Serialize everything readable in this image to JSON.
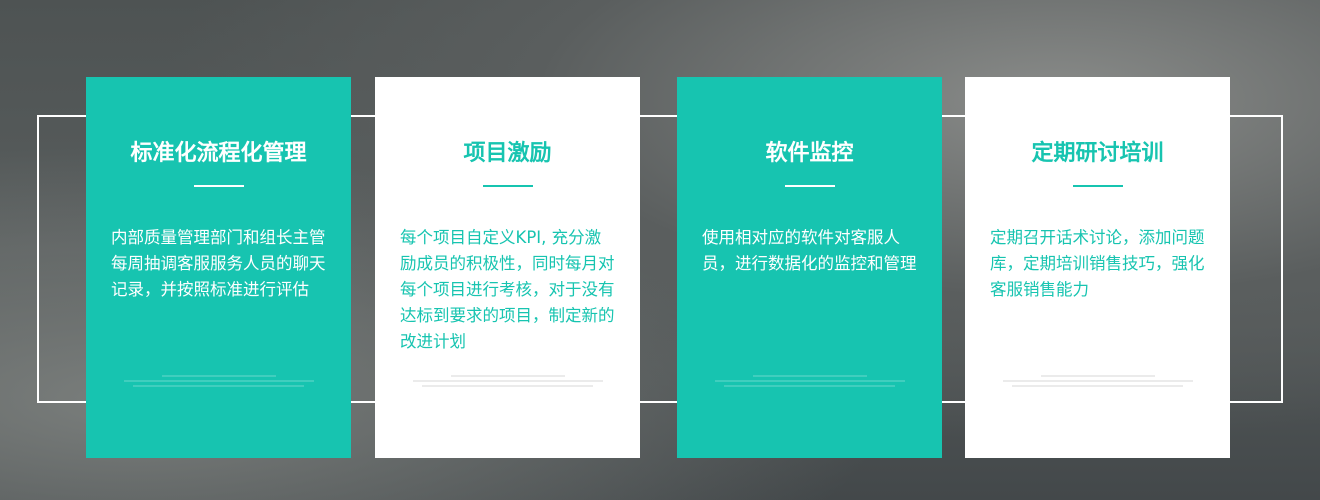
{
  "cards": [
    {
      "title": "标准化流程化管理",
      "body": "内部质量管理部门和组长主管每周抽调客服服务人员的聊天记录，并按照标准进行评估",
      "style": "teal"
    },
    {
      "title": "项目激励",
      "body": "每个项目自定义KPI, 充分激励成员的积极性，同时每月对每个项目进行考核，对于没有达标到要求的项目，制定新的改进计划",
      "style": "white"
    },
    {
      "title": "软件监控",
      "body": "使用相对应的软件对客服人员，进行数据化的监控和管理",
      "style": "teal"
    },
    {
      "title": "定期研讨培训",
      "body": "定期召开话术讨论，添加问题库，定期培训销售技巧，强化客服销售能力",
      "style": "white"
    }
  ],
  "colors": {
    "accent": "#17c4b0"
  }
}
